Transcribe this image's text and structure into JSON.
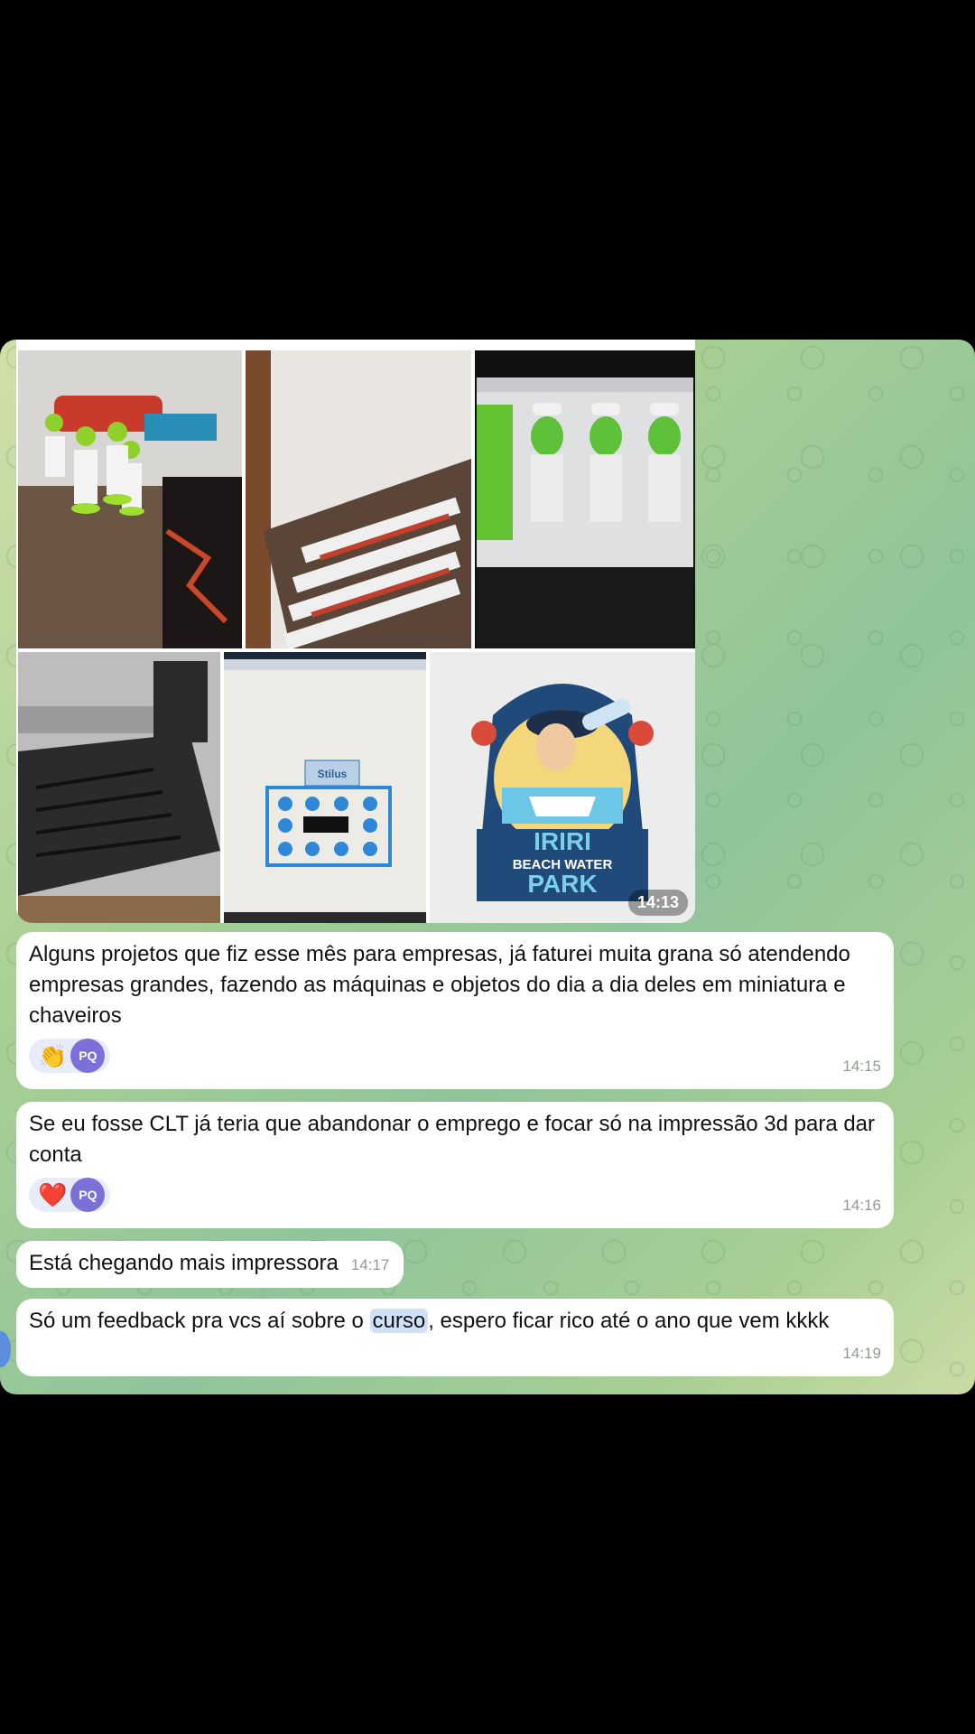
{
  "media": {
    "time": "14:13",
    "logo_text": {
      "line1": "IRIRI",
      "line2": "BEACH WATER",
      "line3": "PARK"
    },
    "screen_label": "Stilus"
  },
  "messages": [
    {
      "text": "Alguns projetos que fiz esse mês para empresas, já faturei muita grana só atendendo empresas grandes, fazendo as máquinas e objetos do dia a dia deles em miniatura e chaveiros",
      "reaction_emoji": "👏",
      "reaction_avatar": "PQ",
      "time": "14:15"
    },
    {
      "text": "Se eu fosse CLT já teria que abandonar o emprego e focar só na impressão 3d para dar conta",
      "reaction_emoji": "❤️",
      "reaction_avatar": "PQ",
      "time": "14:16"
    },
    {
      "text": "Está chegando mais impressora",
      "time": "14:17"
    },
    {
      "text_before": "Só um feedback pra vcs aí sobre o ",
      "highlight": "curso",
      "text_after": ", espero ficar rico até o ano que vem kkkk",
      "time": "14:19"
    }
  ]
}
